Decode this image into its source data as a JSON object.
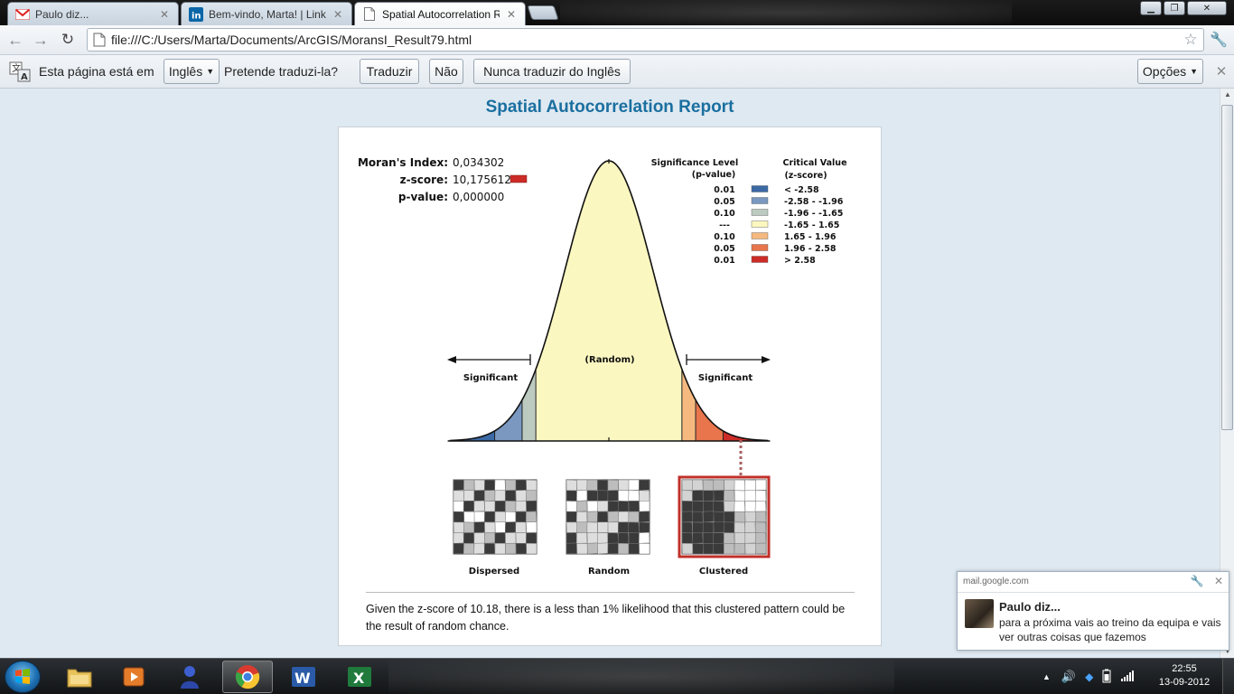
{
  "browser": {
    "tabs": [
      {
        "title": "Paulo diz...",
        "icon": "gmail-icon",
        "active": false
      },
      {
        "title": "Bem-vindo, Marta! | LinkedIn",
        "icon": "linkedin-icon",
        "active": false
      },
      {
        "title": "Spatial Autocorrelation Report",
        "icon": "page-icon",
        "active": true
      }
    ],
    "url": "file:///C:/Users/Marta/Documents/ArcGIS/MoransI_Result79.html"
  },
  "translate_bar": {
    "prefix": "Esta página está em",
    "language": "Inglês",
    "question": "Pretende traduzi-la?",
    "translate_label": "Traduzir",
    "no_label": "Não",
    "never_label": "Nunca traduzir do Inglês",
    "options_label": "Opções"
  },
  "report": {
    "title": "Spatial Autocorrelation Report",
    "morans_index_label": "Moran's Index:",
    "morans_index_value": "0,034302",
    "z_score_label": "z-score:",
    "z_score_value": "10,175612",
    "p_value_label": "p-value:",
    "p_value_value": "0,000000",
    "significance_header": [
      "Significance Level",
      "(p-value)"
    ],
    "critical_header": [
      "Critical Value",
      "(z-score)"
    ],
    "legend": [
      {
        "p": "0.01",
        "z": "< -2.58",
        "color": "#3b6aa5"
      },
      {
        "p": "0.05",
        "z": "-2.58 - -1.96",
        "color": "#7a98c0"
      },
      {
        "p": "0.10",
        "z": "-1.96 - -1.65",
        "color": "#bccabf"
      },
      {
        "p": "---",
        "z": "-1.65 - 1.65",
        "color": "#fbf7c0"
      },
      {
        "p": "0.10",
        "z": "1.65 - 1.96",
        "color": "#f5b97f"
      },
      {
        "p": "0.05",
        "z": "1.96 - 2.58",
        "color": "#e8754c"
      },
      {
        "p": "0.01",
        "z": "> 2.58",
        "color": "#cd2b27"
      }
    ],
    "random_label": "(Random)",
    "significant_left": "Significant",
    "significant_right": "Significant",
    "pattern_labels": [
      "Dispersed",
      "Random",
      "Clustered"
    ],
    "selected_pattern": "Clustered",
    "conclusion": "Given the z-score of 10.18, there is a less than 1% likelihood that this clustered pattern could be the result of random chance."
  },
  "notification": {
    "source": "mail.google.com",
    "sender": "Paulo diz...",
    "message": "para a próxima vais ao treino da equipa e vais ver outras coisas que fazemos"
  },
  "taskbar": {
    "apps": [
      "windows-explorer",
      "media-player",
      "user-app",
      "google-chrome",
      "microsoft-word",
      "microsoft-excel"
    ],
    "active_app": "google-chrome",
    "time": "22:55",
    "date": "13-09-2012"
  },
  "colors": {
    "title_blue": "#1a6fa0",
    "page_bg": "#dfe9f1",
    "random_fill": "#fbf7c0",
    "selected_border": "#c0302a"
  }
}
